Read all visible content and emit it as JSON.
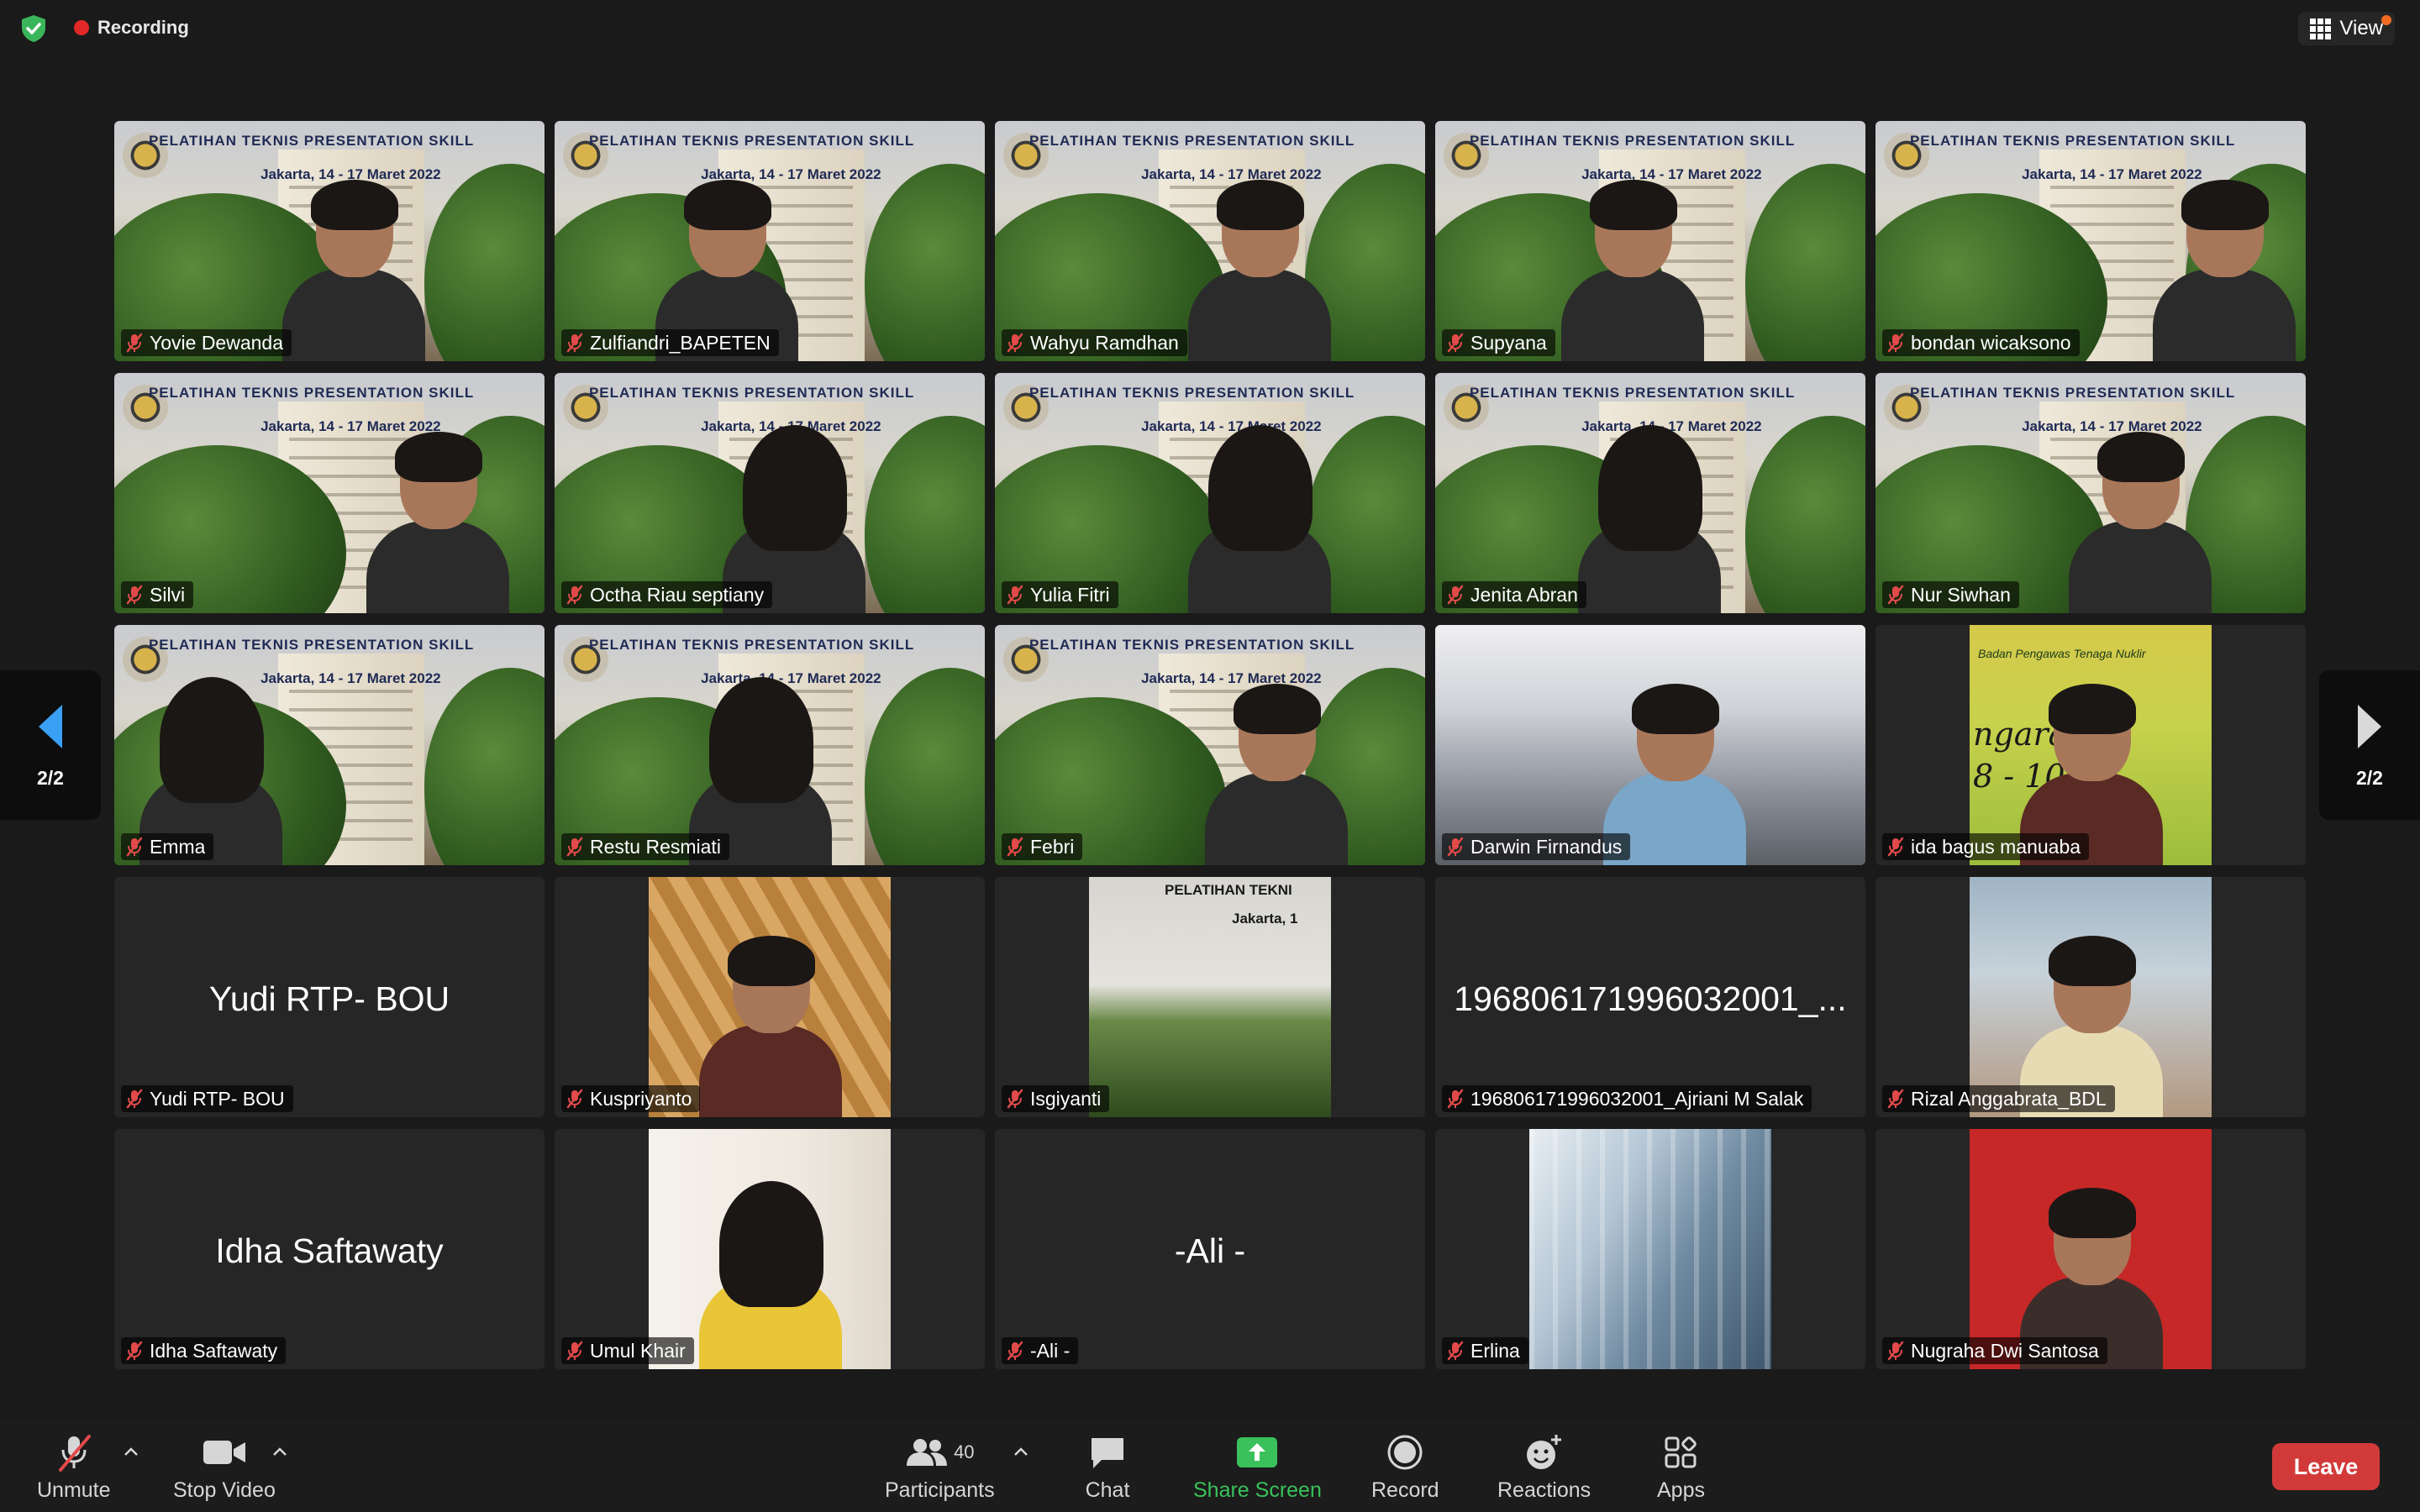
{
  "app": "Zoom Meeting",
  "recording": {
    "label": "Recording",
    "color": "#e02828"
  },
  "view_button": {
    "label": "View"
  },
  "pager": {
    "left_label": "2/2",
    "right_label": "2/2"
  },
  "banner": {
    "title": "PELATIHAN TEKNIS PRESENTATION SKILL",
    "subtitle": "Jakarta, 14 - 17 Maret 2022"
  },
  "photo_text": {
    "bapeten_line1": "Badan Pengawas Tenaga Nuklir",
    "bapeten_line2": "ngaran P",
    "bapeten_line3": "8 - 10",
    "isg_line1": "PELATIHAN TEKNI",
    "isg_line2": "Jakarta, 1"
  },
  "participants": [
    {
      "name": "Yovie Dewanda",
      "bg": "banner"
    },
    {
      "name": "Zulfiandri_BAPETEN",
      "bg": "banner"
    },
    {
      "name": "Wahyu Ramdhan",
      "bg": "banner"
    },
    {
      "name": "Supyana",
      "bg": "banner"
    },
    {
      "name": "bondan wicaksono",
      "bg": "banner"
    },
    {
      "name": "Silvi",
      "bg": "banner"
    },
    {
      "name": "Octha Riau septiany",
      "bg": "banner"
    },
    {
      "name": "Yulia Fitri",
      "bg": "banner"
    },
    {
      "name": "Jenita Abran",
      "bg": "banner"
    },
    {
      "name": "Nur Siwhan",
      "bg": "banner"
    },
    {
      "name": "Emma",
      "bg": "banner"
    },
    {
      "name": "Restu Resmiati",
      "bg": "banner"
    },
    {
      "name": "Febri",
      "bg": "banner"
    },
    {
      "name": "Darwin Firnandus",
      "bg": "car"
    },
    {
      "name": "ida bagus manuaba",
      "bg": "photo-bapeten"
    },
    {
      "name": "Yudi RTP- BOU",
      "center": "Yudi RTP- BOU"
    },
    {
      "name": "Kuspriyanto",
      "bg": "photo-gold"
    },
    {
      "name": "Isgiyanti",
      "bg": "photo-isg"
    },
    {
      "name": "196806171996032001_Ajriani M Salak",
      "center": "196806171996032001_..."
    },
    {
      "name": "Rizal Anggabrata_BDL",
      "bg": "photo-mask"
    },
    {
      "name": "Idha Saftawaty",
      "center": "Idha Saftawaty"
    },
    {
      "name": "Umul Khair",
      "bg": "photo-flag"
    },
    {
      "name": "-Ali -",
      "center": "-Ali -"
    },
    {
      "name": "Erlina",
      "bg": "photo-city"
    },
    {
      "name": "Nugraha Dwi Santosa",
      "bg": "photo-red"
    }
  ],
  "toolbar": {
    "unmute": "Unmute",
    "stop_video": "Stop Video",
    "participants": "Participants",
    "participants_count": "40",
    "chat": "Chat",
    "share_screen": "Share Screen",
    "record": "Record",
    "reactions": "Reactions",
    "apps": "Apps",
    "leave": "Leave"
  },
  "colors": {
    "share_green": "#3ac15b",
    "leave_red": "#d23a3a",
    "mute_red": "#e24a4a",
    "shield_green": "#3bb55a"
  },
  "icons": [
    "shield-icon",
    "record-dot-icon",
    "grid-view-icon",
    "chevron-left-icon",
    "chevron-right-icon",
    "mic-muted-icon",
    "video-camera-icon",
    "participants-icon",
    "chat-bubble-icon",
    "share-arrow-icon",
    "record-icon",
    "reactions-icon",
    "apps-icon"
  ]
}
